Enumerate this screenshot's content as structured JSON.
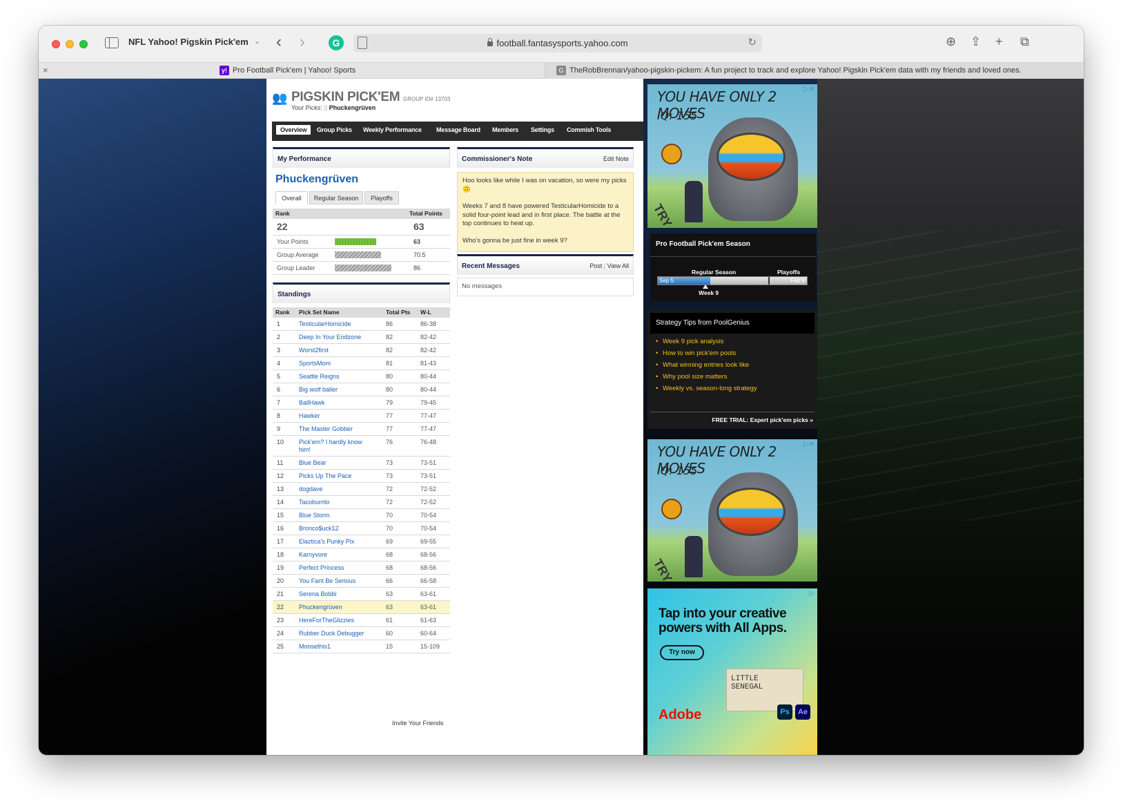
{
  "browser": {
    "tab_group_title": "NFL Yahoo! Pigskin Pick'em",
    "url": "football.fantasysports.yahoo.com",
    "tabs": [
      {
        "label": "Pro Football Pick'em | Yahoo! Sports",
        "favicon": "yahoo-icon"
      },
      {
        "label": "TheRobBrennan/yahoo-pigskin-pickem: A fun project to track and explore Yahoo! Pigskin Pick'em data with my friends and loved ones.",
        "favicon": "github-icon"
      }
    ]
  },
  "header": {
    "logo": "PIGSKIN PICK'EM",
    "group_id": "GROUP ID# 13703",
    "your_picks_label": "Your Picks:",
    "your_picks_name": "Phuckengrüven"
  },
  "nav": {
    "items": [
      "Overview",
      "Group Picks",
      "Weekly Performance",
      "Message Board",
      "Members",
      "Settings",
      "Commish Tools"
    ],
    "active": "Overview"
  },
  "performance": {
    "title": "My Performance",
    "name": "Phuckengrüven",
    "tabs": [
      "Overall",
      "Regular Season",
      "Playoffs"
    ],
    "col_rank": "Rank",
    "col_total": "Total Points",
    "rank": "22",
    "total": "63",
    "rows": [
      {
        "label": "Your Points",
        "value": "63",
        "fraction": 0.73
      },
      {
        "label": "Group Average",
        "value": "70.5",
        "fraction": 0.82
      },
      {
        "label": "Group Leader",
        "value": "86",
        "fraction": 1.0
      }
    ]
  },
  "standings": {
    "title": "Standings",
    "columns": [
      "Rank",
      "Pick Set Name",
      "Total Pts",
      "W-L"
    ],
    "rows": [
      {
        "rank": "1",
        "name": "TesticularHomicide",
        "pts": "86",
        "wl": "86-38"
      },
      {
        "rank": "2",
        "name": "Deep In Your Endzone",
        "pts": "82",
        "wl": "82-42"
      },
      {
        "rank": "3",
        "name": "Worst2first",
        "pts": "82",
        "wl": "82-42"
      },
      {
        "rank": "4",
        "name": "SportsMom",
        "pts": "81",
        "wl": "81-43"
      },
      {
        "rank": "5",
        "name": "Seattle Reigns",
        "pts": "80",
        "wl": "80-44"
      },
      {
        "rank": "6",
        "name": "Big wolf baller",
        "pts": "80",
        "wl": "80-44"
      },
      {
        "rank": "7",
        "name": "BallHawk",
        "pts": "79",
        "wl": "79-45"
      },
      {
        "rank": "8",
        "name": "Hawker",
        "pts": "77",
        "wl": "77-47"
      },
      {
        "rank": "9",
        "name": "The Master Gobber",
        "pts": "77",
        "wl": "77-47"
      },
      {
        "rank": "10",
        "name": "Pick'em? I hardly know him!",
        "pts": "76",
        "wl": "76-48"
      },
      {
        "rank": "11",
        "name": "Blue Bear",
        "pts": "73",
        "wl": "73-51"
      },
      {
        "rank": "12",
        "name": "Picks Up The Pace",
        "pts": "73",
        "wl": "73-51"
      },
      {
        "rank": "13",
        "name": "dogdave",
        "pts": "72",
        "wl": "72-52"
      },
      {
        "rank": "14",
        "name": "Tacoburrito",
        "pts": "72",
        "wl": "72-52"
      },
      {
        "rank": "15",
        "name": "Blue Storm",
        "pts": "70",
        "wl": "70-54"
      },
      {
        "rank": "16",
        "name": "Bronco$uck12",
        "pts": "70",
        "wl": "70-54"
      },
      {
        "rank": "17",
        "name": "Elaztica's Punky Pix",
        "pts": "69",
        "wl": "69-55"
      },
      {
        "rank": "18",
        "name": "Karnyvore",
        "pts": "68",
        "wl": "68-56"
      },
      {
        "rank": "19",
        "name": "Perfect Princess",
        "pts": "68",
        "wl": "68-56"
      },
      {
        "rank": "20",
        "name": "You Fant Be Serious",
        "pts": "66",
        "wl": "66-58"
      },
      {
        "rank": "21",
        "name": "Serena Bobbi",
        "pts": "63",
        "wl": "63-61"
      },
      {
        "rank": "22",
        "name": "Phuckengrüven",
        "pts": "63",
        "wl": "63-61"
      },
      {
        "rank": "23",
        "name": "HereForTheGlizzies",
        "pts": "61",
        "wl": "61-63"
      },
      {
        "rank": "24",
        "name": "Rubber Duck Debugger",
        "pts": "60",
        "wl": "60-64"
      },
      {
        "rank": "25",
        "name": "Moosethis1",
        "pts": "15",
        "wl": "15-109"
      }
    ],
    "highlight_rank": "22",
    "invite": "Invite Your Friends"
  },
  "commissioner": {
    "title": "Commissioner's Note",
    "edit": "Edit Note",
    "paragraphs": [
      "Hoo looks like while I was on vacation, so were my picks 🙃",
      "Weeks 7 and 8 have powered TesticularHomicide to a solid four-point lead and in first place. The battle at the top continues to heat up.",
      "Who's gonna be just fine in week 9?"
    ]
  },
  "messages": {
    "title": "Recent Messages",
    "post": "Post",
    "sep": "|",
    "view_all": "View All",
    "empty": "No messages"
  },
  "ads": {
    "game_headline": "YOU HAVE ONLY 2 MOVES",
    "game_iq": "IQ: 155",
    "game_try": "TRY",
    "adobe_headline_1": "Tap into your creative",
    "adobe_headline_2": "powers with All Apps.",
    "adobe_button": "Try now",
    "adobe_logo": "Adobe",
    "adobe_card": "LITTLE SENEGAL",
    "adobe_app_1": "Ps",
    "adobe_app_2": "Ae"
  },
  "season": {
    "title": "Pro Football Pick'em Season",
    "regular": "Regular Season",
    "playoffs": "Playoffs",
    "start": "Sep 5",
    "end": "Feb 9",
    "week": "Week 9",
    "progress": 0.35
  },
  "tips": {
    "title": "Strategy Tips from PoolGenius",
    "items": [
      "Week 9 pick analysis",
      "How to win pick'em pools",
      "What winning entries look like",
      "Why pool size matters",
      "Weekly vs. season-long strategy"
    ],
    "trial": "FREE TRIAL: Expert pick'em picks »"
  },
  "colors": {
    "link": "#1a5fb4",
    "panel_accent": "#1a2448",
    "tip_link": "#f4c21c",
    "highlight_row": "#fbf5c9"
  }
}
